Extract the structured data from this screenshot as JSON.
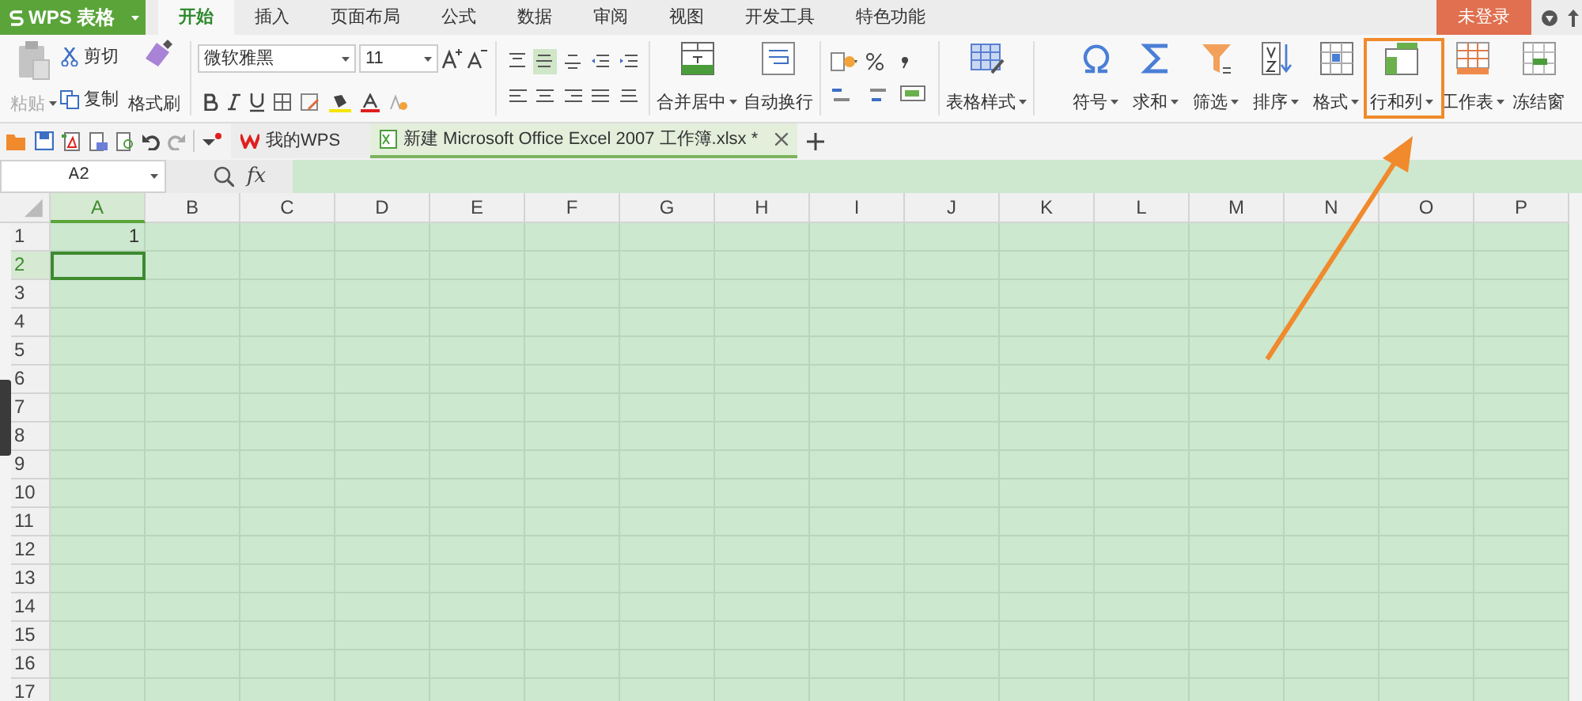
{
  "app_button": {
    "label": "WPS 表格"
  },
  "tabs": [
    {
      "label": "开始",
      "selected": true
    },
    {
      "label": "插入",
      "selected": false
    },
    {
      "label": "页面布局",
      "selected": false
    },
    {
      "label": "公式",
      "selected": false
    },
    {
      "label": "数据",
      "selected": false
    },
    {
      "label": "审阅",
      "selected": false
    },
    {
      "label": "视图",
      "selected": false
    },
    {
      "label": "开发工具",
      "selected": false
    },
    {
      "label": "特色功能",
      "selected": false
    }
  ],
  "login_button": {
    "label": "未登录"
  },
  "ribbon": {
    "clipboard": {
      "paste": {
        "label": "粘贴",
        "disabled": true
      },
      "cut": "剪切",
      "copy": "复制",
      "format_painter": "格式刷"
    },
    "font": {
      "name": "微软雅黑",
      "size": "11"
    },
    "align_buttons": [
      {
        "kind": "top",
        "selected": false
      },
      {
        "kind": "middle",
        "selected": true
      },
      {
        "kind": "bottom",
        "selected": false
      },
      {
        "kind": "outdent",
        "selected": false
      },
      {
        "kind": "indent",
        "selected": false
      },
      {
        "kind": "left",
        "selected": false
      },
      {
        "kind": "center",
        "selected": false
      },
      {
        "kind": "right",
        "selected": false
      },
      {
        "kind": "justify",
        "selected": false
      },
      {
        "kind": "distributed",
        "selected": false
      }
    ],
    "merge": "合并居中",
    "wrap": "自动换行",
    "table_style": "表格样式",
    "tools": [
      {
        "label": "符号",
        "kind": "symbol"
      },
      {
        "label": "求和",
        "kind": "sum"
      },
      {
        "label": "筛选",
        "kind": "filter"
      },
      {
        "label": "排序",
        "kind": "sort"
      },
      {
        "label": "格式",
        "kind": "format"
      },
      {
        "label": "行和列",
        "kind": "rowcol"
      },
      {
        "label": "工作表",
        "kind": "sheet"
      },
      {
        "label": "冻结窗",
        "kind": "freeze"
      }
    ]
  },
  "doc_tabs": [
    {
      "label": "我的WPS",
      "kind": "home",
      "selected": false
    },
    {
      "label": "新建 Microsoft Office Excel 2007 工作簿.xlsx *",
      "kind": "workbook",
      "selected": true
    }
  ],
  "formula_bar": {
    "name_box": "A2",
    "fx_label": "fx"
  },
  "sheet": {
    "columns": [
      {
        "label": "A",
        "selected": true
      },
      {
        "label": "B",
        "selected": false
      },
      {
        "label": "C",
        "selected": false
      },
      {
        "label": "D",
        "selected": false
      },
      {
        "label": "E",
        "selected": false
      },
      {
        "label": "F",
        "selected": false
      },
      {
        "label": "G",
        "selected": false
      },
      {
        "label": "H",
        "selected": false
      },
      {
        "label": "I",
        "selected": false
      },
      {
        "label": "J",
        "selected": false
      },
      {
        "label": "K",
        "selected": false
      },
      {
        "label": "L",
        "selected": false
      },
      {
        "label": "M",
        "selected": false
      },
      {
        "label": "N",
        "selected": false
      },
      {
        "label": "O",
        "selected": false
      },
      {
        "label": "P",
        "selected": false
      }
    ],
    "rows": [
      {
        "number": "1",
        "selected": false,
        "values": [
          "1"
        ]
      },
      {
        "number": "2",
        "selected": true,
        "values": []
      },
      {
        "number": "3",
        "selected": false,
        "values": []
      },
      {
        "number": "4",
        "selected": false,
        "values": []
      },
      {
        "number": "5",
        "selected": false,
        "values": []
      },
      {
        "number": "6",
        "selected": false,
        "values": []
      },
      {
        "number": "7",
        "selected": false,
        "values": []
      },
      {
        "number": "8",
        "selected": false,
        "values": []
      },
      {
        "number": "9",
        "selected": false,
        "values": []
      },
      {
        "number": "10",
        "selected": false,
        "values": []
      },
      {
        "number": "11",
        "selected": false,
        "values": []
      },
      {
        "number": "12",
        "selected": false,
        "values": []
      },
      {
        "number": "13",
        "selected": false,
        "values": []
      },
      {
        "number": "14",
        "selected": false,
        "values": []
      },
      {
        "number": "15",
        "selected": false,
        "values": []
      },
      {
        "number": "16",
        "selected": false,
        "values": []
      },
      {
        "number": "17",
        "selected": false,
        "values": []
      }
    ]
  }
}
